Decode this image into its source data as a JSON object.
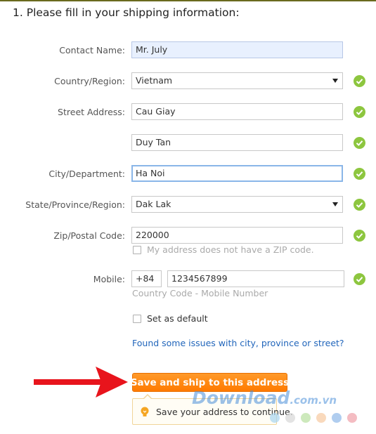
{
  "section": {
    "title": "1. Please fill in your shipping information:"
  },
  "form": {
    "contact_name": {
      "label": "Contact Name:",
      "value": "Mr. July"
    },
    "country": {
      "label": "Country/Region:",
      "value": "Vietnam"
    },
    "street": {
      "label": "Street Address:",
      "value": "Cau Giay",
      "value2": "Duy Tan"
    },
    "city": {
      "label": "City/Department:",
      "value": "Ha Noi"
    },
    "state": {
      "label": "State/Province/Region:",
      "value": "Dak Lak"
    },
    "zip": {
      "label": "Zip/Postal Code:",
      "value": "220000",
      "no_zip_label": "My address does not have a ZIP code."
    },
    "mobile": {
      "label": "Mobile:",
      "country_code": "+84",
      "number": "1234567899",
      "hint": "Country Code - Mobile Number"
    },
    "default": {
      "label": "Set as default"
    },
    "issues_link": "Found some issues with city, province or street?",
    "save_button": "Save and ship to this address",
    "tooltip": "Save your address to continue."
  },
  "colors": {
    "accent_orange": "#ff8a00",
    "check_green": "#8dc63f",
    "link_blue": "#2266bb",
    "arrow_red": "#e8141c"
  },
  "watermark": {
    "main": "Download",
    "suffix": ".com.vn"
  }
}
